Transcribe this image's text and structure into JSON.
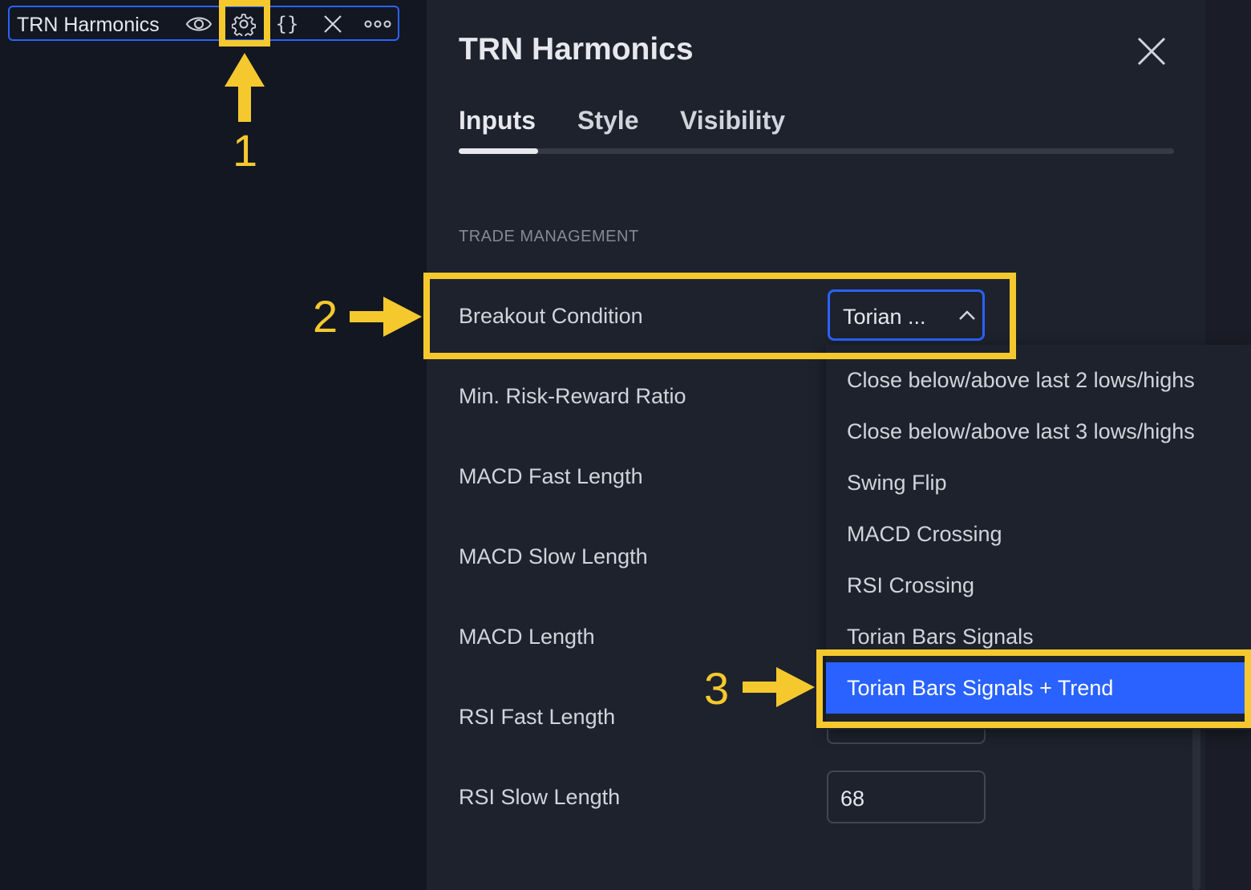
{
  "legend": {
    "title": "TRN Harmonics",
    "buttons": [
      {
        "name": "visibility",
        "icon": "eye-icon"
      },
      {
        "name": "settings",
        "icon": "gear-icon"
      },
      {
        "name": "source-code",
        "icon": "braces-icon",
        "glyph": "{}"
      },
      {
        "name": "remove",
        "icon": "close-icon"
      },
      {
        "name": "more",
        "icon": "more-icon"
      }
    ]
  },
  "dialog": {
    "title": "TRN Harmonics",
    "tabs": [
      {
        "label": "Inputs",
        "active": true
      },
      {
        "label": "Style",
        "active": false
      },
      {
        "label": "Visibility",
        "active": false
      }
    ],
    "section_title": "TRADE MANAGEMENT",
    "rows": [
      {
        "label": "Breakout Condition",
        "value": "Torian ..."
      },
      {
        "label": "Min. Risk-Reward Ratio"
      },
      {
        "label": "MACD Fast Length"
      },
      {
        "label": "MACD Slow Length"
      },
      {
        "label": "MACD Length"
      },
      {
        "label": "RSI Fast Length"
      },
      {
        "label": "RSI Slow Length",
        "value": "68"
      }
    ]
  },
  "dropdown": {
    "options": [
      "Close below/above last 2 lows/highs",
      "Close below/above last 3 lows/highs",
      "Swing Flip",
      "MACD Crossing",
      "RSI Crossing",
      "Torian Bars Signals",
      "Torian Bars Signals + Trend"
    ],
    "selected_index": 6
  },
  "annotations": {
    "steps": [
      "1",
      "2",
      "3"
    ],
    "color": "#f5c92e"
  },
  "colors": {
    "accent": "#2962ff",
    "background": "#131722",
    "panel": "#1e222d"
  }
}
